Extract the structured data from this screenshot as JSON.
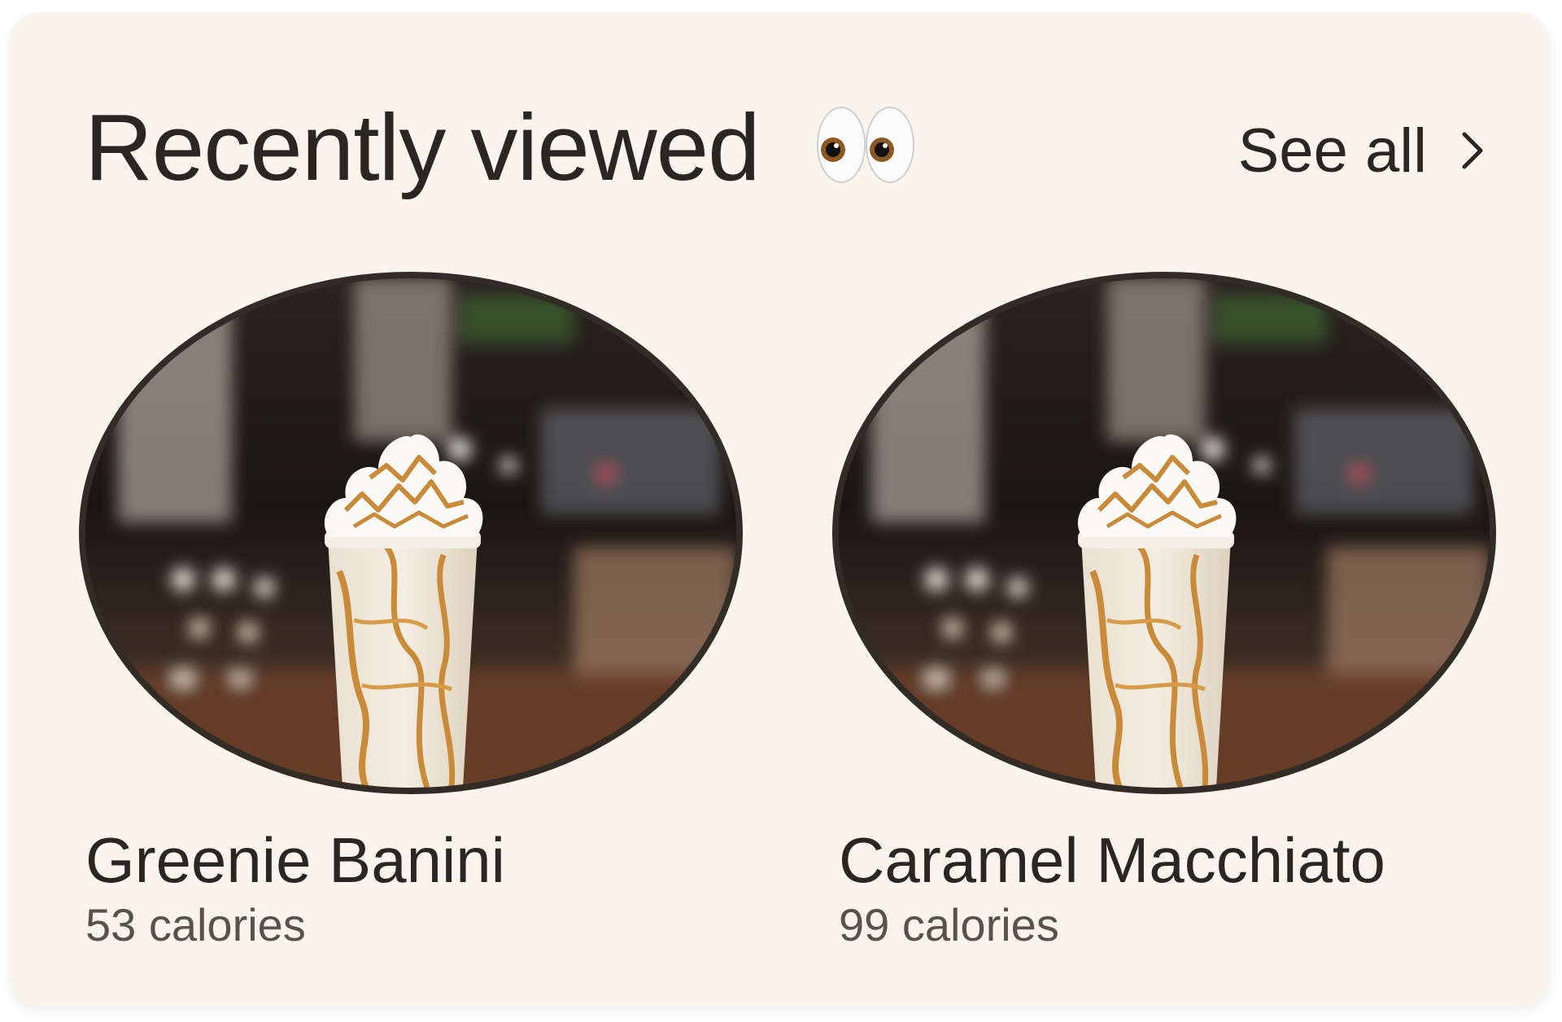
{
  "section": {
    "title": "Recently viewed",
    "title_emoji_icon": "eyes-emoji-icon",
    "see_all_label": "See all",
    "see_all_icon": "chevron-right-icon"
  },
  "items": [
    {
      "name": "Greenie Banini",
      "calories": "53 calories",
      "image": "caramel-frappuccino-photo"
    },
    {
      "name": "Caramel Macchiato",
      "calories": "99 calories",
      "image": "caramel-frappuccino-photo"
    }
  ],
  "colors": {
    "card_background": "#f9f5ec",
    "text_primary": "#2a2723",
    "text_secondary": "#57524c",
    "image_border": "#322c27"
  }
}
